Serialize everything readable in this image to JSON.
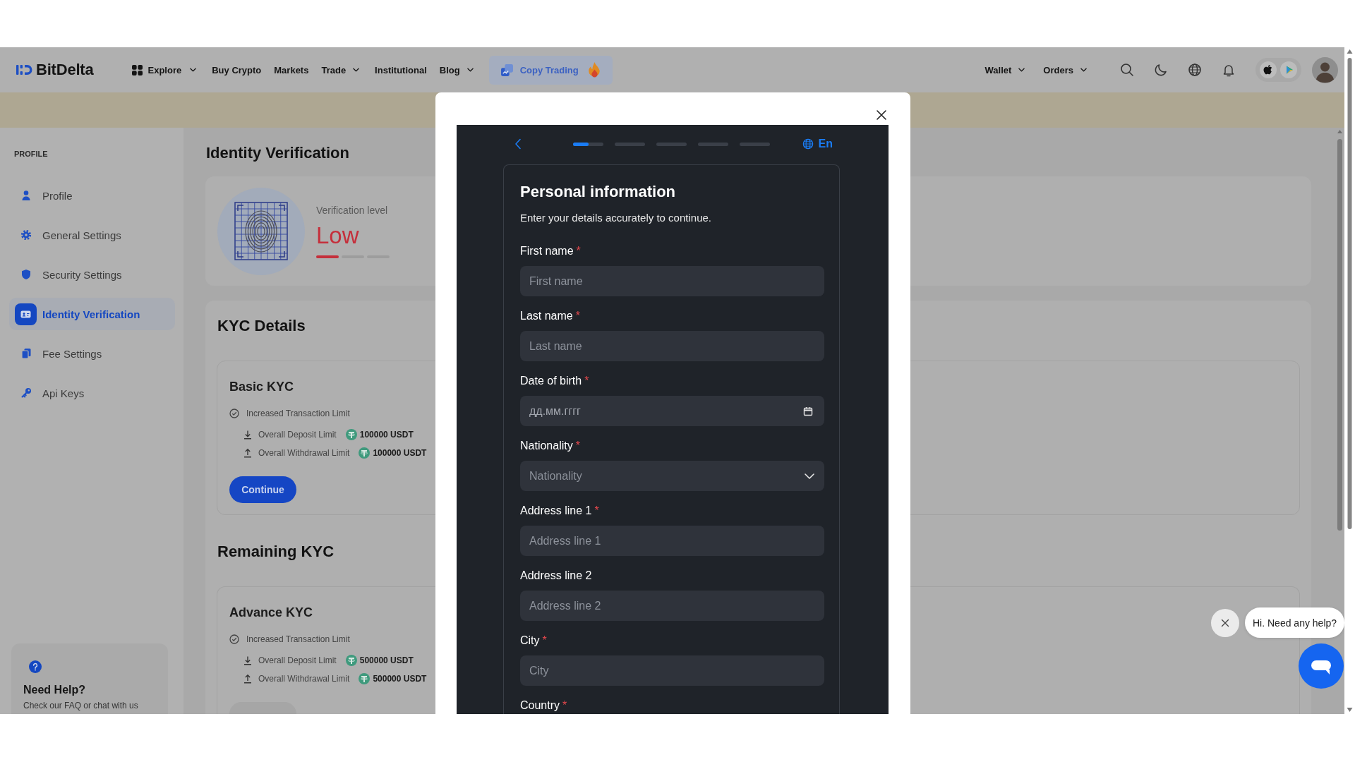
{
  "nav": {
    "logo": "BitDelta",
    "items": [
      {
        "label": "Explore",
        "dropdown": true
      },
      {
        "label": "Buy Crypto",
        "dropdown": false
      },
      {
        "label": "Markets",
        "dropdown": false
      },
      {
        "label": "Trade",
        "dropdown": true
      },
      {
        "label": "Institutional",
        "dropdown": false
      },
      {
        "label": "Blog",
        "dropdown": true
      }
    ],
    "highlight": {
      "label": "Copy Trading"
    },
    "account_items": [
      {
        "label": "Wallet",
        "dropdown": true
      },
      {
        "label": "Orders",
        "dropdown": true
      }
    ]
  },
  "sidebar": {
    "heading": "PROFILE",
    "items": [
      {
        "label": "Profile",
        "selected": false
      },
      {
        "label": "General Settings",
        "selected": false
      },
      {
        "label": "Security Settings",
        "selected": false
      },
      {
        "label": "Identity Verification",
        "selected": true
      },
      {
        "label": "Fee Settings",
        "selected": false
      },
      {
        "label": "Api Keys",
        "selected": false
      }
    ],
    "help": {
      "title": "Need Help?",
      "text": "Check our FAQ or chat with us"
    }
  },
  "page": {
    "title": "Identity Verification",
    "verification": {
      "label": "Verification level",
      "value": "Low",
      "segments": [
        {
          "on": true
        },
        {
          "on": false
        },
        {
          "on": false
        }
      ]
    },
    "sections": [
      {
        "title": "KYC Details",
        "cards": [
          {
            "title": "Basic KYC",
            "benefit": "Increased Transaction Limit",
            "limits": [
              {
                "kind": "deposit",
                "label": "Overall Deposit Limit",
                "value": "100000 USDT"
              },
              {
                "kind": "withdrawal",
                "label": "Overall Withdrawal Limit",
                "value": "100000 USDT"
              }
            ],
            "button": {
              "label": "Continue",
              "disabled": false
            }
          }
        ]
      },
      {
        "title": "Remaining KYC",
        "cards": [
          {
            "title": "Advance KYC",
            "benefit": "Increased Transaction Limit",
            "limits": [
              {
                "kind": "deposit",
                "label": "Overall Deposit Limit",
                "value": "500000 USDT"
              },
              {
                "kind": "withdrawal",
                "label": "Overall Withdrawal Limit",
                "value": "500000 USDT"
              }
            ],
            "button": {
              "disabled": true
            }
          }
        ]
      }
    ]
  },
  "modal": {
    "steps": [
      {
        "current": true
      },
      {
        "current": false
      },
      {
        "current": false
      },
      {
        "current": false
      },
      {
        "current": false
      }
    ],
    "language": "En",
    "title": "Personal information",
    "subtitle": "Enter your details accurately to continue.",
    "required_mark": "*",
    "fields": [
      {
        "kind": "text",
        "label": "First name",
        "required": true,
        "placeholder": "First name"
      },
      {
        "kind": "text",
        "label": "Last name",
        "required": true,
        "placeholder": "Last name"
      },
      {
        "kind": "date",
        "label": "Date of birth",
        "required": true,
        "placeholder": "дд.мм.гггг"
      },
      {
        "kind": "select",
        "label": "Nationality",
        "required": true,
        "placeholder": "Nationality"
      },
      {
        "kind": "text",
        "label": "Address line 1",
        "required": true,
        "placeholder": "Address line 1"
      },
      {
        "kind": "text",
        "label": "Address line 2",
        "required": false,
        "placeholder": "Address line 2"
      },
      {
        "kind": "text",
        "label": "City",
        "required": true,
        "placeholder": "City"
      },
      {
        "label": "Country",
        "required": true
      }
    ]
  },
  "chat": {
    "message": "Hi. Need any help?"
  }
}
